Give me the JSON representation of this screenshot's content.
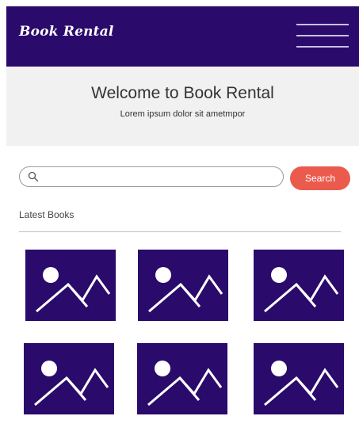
{
  "header": {
    "brand": "Book Rental",
    "menu_icon": "hamburger-icon",
    "background_color": "#2a0a6b"
  },
  "hero": {
    "title": "Welcome to Book Rental",
    "subtitle": "Lorem ipsum dolor sit ametmpor"
  },
  "search": {
    "icon": "search-icon",
    "value": "",
    "placeholder": "",
    "button_label": "Search",
    "button_color": "#ea5b4e"
  },
  "latest": {
    "title": "Latest Books",
    "books": [
      {
        "thumbnail_icon": "image-placeholder-icon"
      },
      {
        "thumbnail_icon": "image-placeholder-icon"
      },
      {
        "thumbnail_icon": "image-placeholder-icon"
      },
      {
        "thumbnail_icon": "image-placeholder-icon"
      },
      {
        "thumbnail_icon": "image-placeholder-icon"
      },
      {
        "thumbnail_icon": "image-placeholder-icon"
      }
    ]
  }
}
